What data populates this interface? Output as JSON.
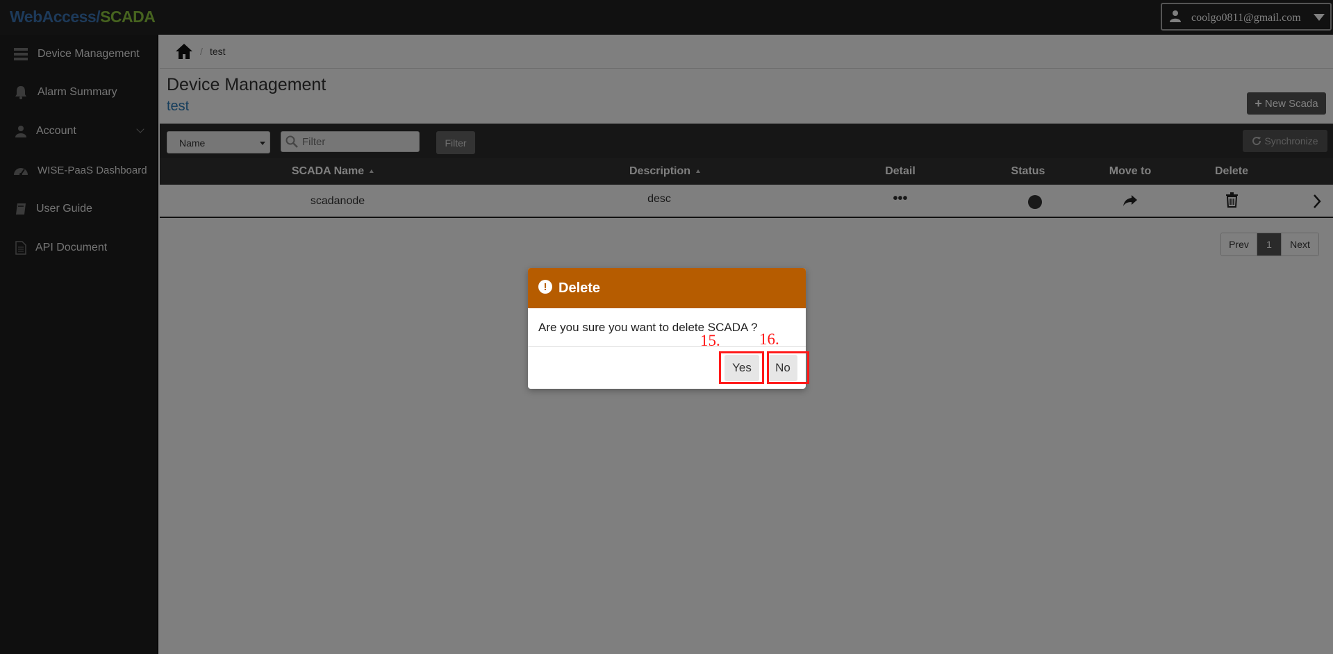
{
  "header": {
    "logo_part1": "WebAccess/",
    "logo_part2": "SCADA",
    "user_email": "coolgo0811@gmail.com"
  },
  "sidebar": {
    "items": [
      {
        "label": "Device Management",
        "icon": "server-icon"
      },
      {
        "label": "Alarm Summary",
        "icon": "bell-icon"
      },
      {
        "label": "Account",
        "icon": "user-icon"
      },
      {
        "label": "WISE-PaaS Dashboard",
        "icon": "dashboard-icon"
      },
      {
        "label": "User Guide",
        "icon": "book-icon"
      },
      {
        "label": "API Document",
        "icon": "document-icon"
      }
    ]
  },
  "breadcrumb": {
    "separator": "/",
    "current": "test"
  },
  "page": {
    "title": "Device Management",
    "subtitle": "test",
    "new_scada_label": "New Scada"
  },
  "toolbar": {
    "select_value": "Name",
    "filter_placeholder": "Filter",
    "filter_button": "Filter",
    "sync_button": "Synchronize"
  },
  "table": {
    "columns": [
      "SCADA Name",
      "Description",
      "Detail",
      "Status",
      "Move to",
      "Delete"
    ],
    "rows": [
      {
        "name": "scadanode",
        "description": "desc",
        "detail": "•••"
      }
    ]
  },
  "pagination": {
    "prev": "Prev",
    "current": "1",
    "next": "Next"
  },
  "modal": {
    "title": "Delete",
    "message": "Are you sure you want to delete SCADA ?",
    "yes_label": "Yes",
    "no_label": "No"
  },
  "annotations": {
    "label_yes": "15.",
    "label_no": "16."
  },
  "colors": {
    "modal_header": "#b65c00",
    "annotation": "#ff1a1a",
    "subtitle_link": "#2a7ab8",
    "logo_blue": "#3a74b5",
    "logo_green": "#8cc63f"
  }
}
